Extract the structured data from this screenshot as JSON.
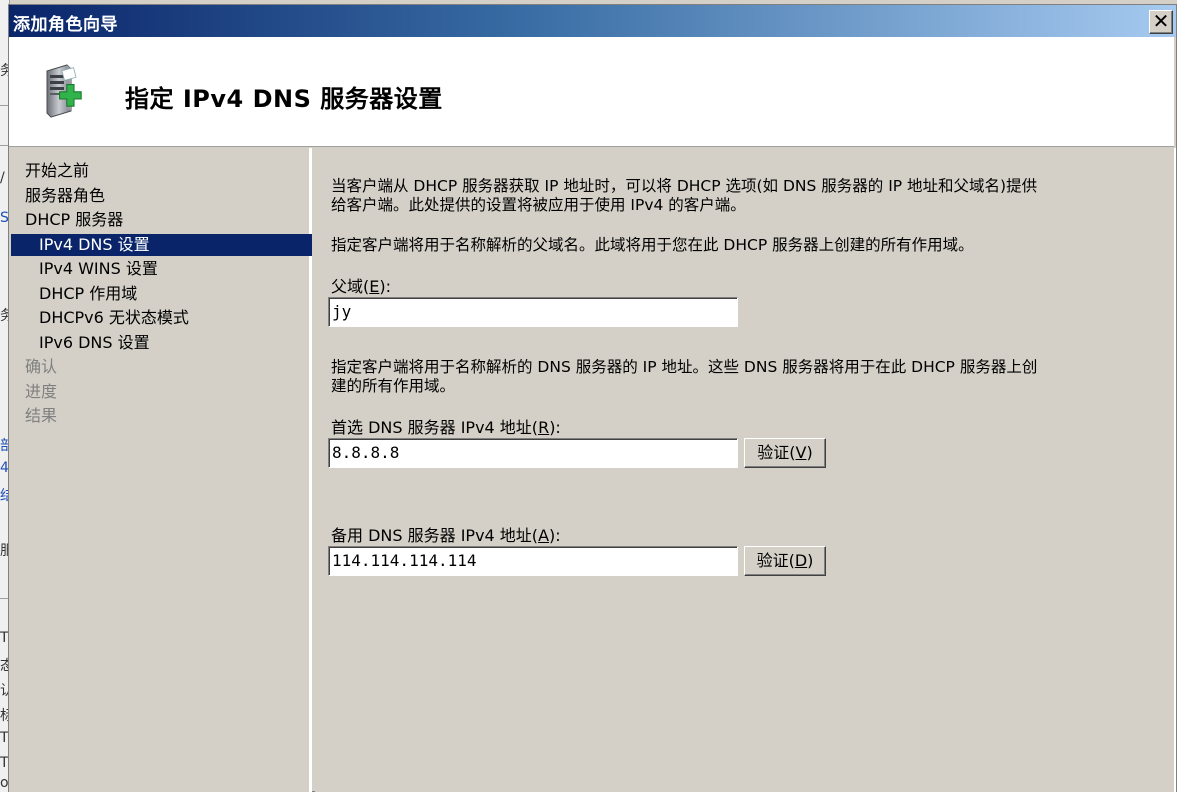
{
  "window": {
    "title": "添加角色向导",
    "close_glyph": "✕"
  },
  "header": {
    "title": "指定 IPv4 DNS 服务器设置",
    "icon": "server-add-icon"
  },
  "nav": {
    "items": [
      {
        "label": "开始之前",
        "state": "normal",
        "level": 0
      },
      {
        "label": "服务器角色",
        "state": "normal",
        "level": 0
      },
      {
        "label": "DHCP 服务器",
        "state": "normal",
        "level": 0
      },
      {
        "label": "IPv4 DNS 设置",
        "state": "selected",
        "level": 1
      },
      {
        "label": "IPv4 WINS 设置",
        "state": "normal",
        "level": 1
      },
      {
        "label": "DHCP 作用域",
        "state": "normal",
        "level": 1
      },
      {
        "label": "DHCPv6 无状态模式",
        "state": "normal",
        "level": 1
      },
      {
        "label": "IPv6 DNS 设置",
        "state": "normal",
        "level": 1
      },
      {
        "label": "确认",
        "state": "disabled",
        "level": 0
      },
      {
        "label": "进度",
        "state": "disabled",
        "level": 0
      },
      {
        "label": "结果",
        "state": "disabled",
        "level": 0
      }
    ]
  },
  "content": {
    "intro_line1": "当客户端从 DHCP 服务器获取 IP 地址时，可以将 DHCP 选项(如 DNS 服务器的 IP 地址和父域名)提供",
    "intro_line2": "给客户端。此处提供的设置将被应用于使用 IPv4 的客户端。",
    "parent_domain_desc": "指定客户端将用于名称解析的父域名。此域将用于您在此 DHCP 服务器上创建的所有作用域。",
    "parent_domain_label_pre": "父域(",
    "parent_domain_label_key": "E",
    "parent_domain_label_post": "):",
    "parent_domain_value": "jy",
    "dns_desc_line1": "指定客户端将用于名称解析的 DNS 服务器的 IP 地址。这些 DNS 服务器将用于在此 DHCP 服务器上创",
    "dns_desc_line2": "建的所有作用域。",
    "preferred_label_pre": "首选 DNS 服务器 IPv4 地址(",
    "preferred_label_key": "R",
    "preferred_label_post": "):",
    "preferred_value": "8.8.8.8",
    "preferred_validate_pre": "验证(",
    "preferred_validate_key": "V",
    "preferred_validate_post": ")",
    "alternate_label_pre": "备用 DNS 服务器 IPv4 地址(",
    "alternate_label_key": "A",
    "alternate_label_post": "):",
    "alternate_value": "114.114.114.114",
    "alternate_validate_pre": "验证(",
    "alternate_validate_key": "D",
    "alternate_validate_post": ")"
  },
  "colors": {
    "selected_bg": "#0a246a",
    "face": "#d4d0c8",
    "disabled_text": "#808080"
  }
}
